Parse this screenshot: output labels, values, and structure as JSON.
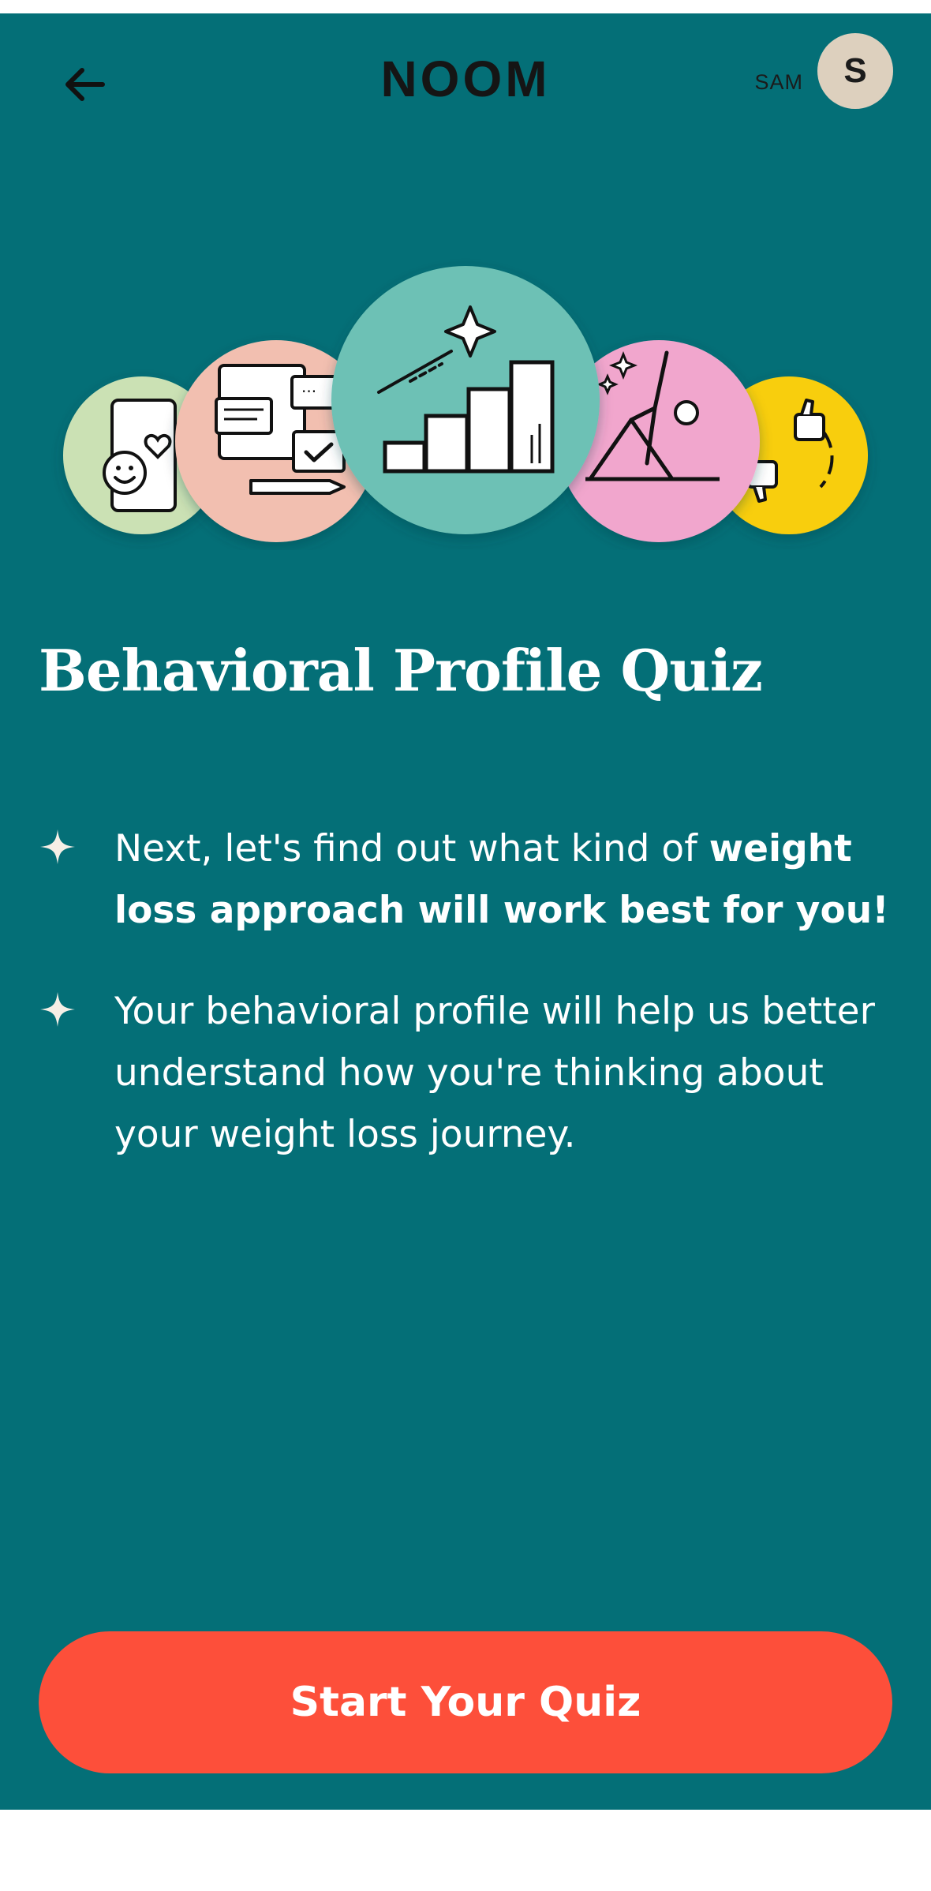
{
  "header": {
    "back_icon": "arrow-left-icon",
    "logo_text": "NOOM",
    "user_name": "SAM",
    "avatar_initial": "S"
  },
  "hero": {
    "circles": [
      {
        "icon": "smiley-heart-phone-icon",
        "color": "#CBE1B4"
      },
      {
        "icon": "documents-checklist-icon",
        "color": "#F2BFB0"
      },
      {
        "icon": "bar-chart-growth-icon",
        "color": "#6DC1B5"
      },
      {
        "icon": "yoga-pose-icon",
        "color": "#F1A6CD"
      },
      {
        "icon": "thumbs-up-down-icon",
        "color": "#F8CE0F"
      }
    ]
  },
  "content": {
    "title": "Behavioral Profile Quiz",
    "bullets": [
      {
        "text": "Next, let's find out what kind of ",
        "bold": "weight loss approach will work best for you!"
      },
      {
        "text": "Your behavioral profile will help us better understand how you're thinking about your weight loss journey.",
        "bold": ""
      }
    ]
  },
  "cta": {
    "label": "Start Your Quiz"
  },
  "colors": {
    "background": "#046F77",
    "button": "#FD4F3A",
    "avatar": "#DDD0BE",
    "text": "#FFFFFF"
  }
}
